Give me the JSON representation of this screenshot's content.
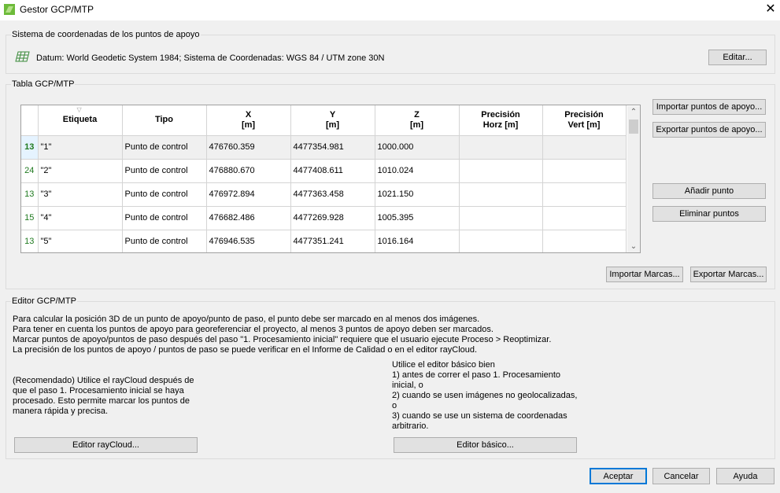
{
  "window": {
    "title": "Gestor GCP/MTP",
    "close": "✕"
  },
  "coords": {
    "group_label": "Sistema de coordenadas de los puntos de apoyo",
    "datum": "Datum: World Geodetic System 1984; Sistema de Coordenadas: WGS 84 / UTM zone 30N",
    "edit_button": "Editar..."
  },
  "table": {
    "group_label": "Tabla GCP/MTP",
    "headers": {
      "label": "Etiqueta",
      "type": "Tipo",
      "x": "X",
      "y": "Y",
      "z": "Z",
      "unit": "[m]",
      "prec": "Precisión",
      "horz": "Horz [m]",
      "vert": "Vert [m]"
    },
    "rows": [
      {
        "count": "13",
        "label": "\"1\"",
        "type": "Punto de control",
        "x": "476760.359",
        "y": "4477354.981",
        "z": "1000.000",
        "ph": "",
        "pv": ""
      },
      {
        "count": "24",
        "label": "\"2\"",
        "type": "Punto de control",
        "x": "476880.670",
        "y": "4477408.611",
        "z": "1010.024",
        "ph": "",
        "pv": ""
      },
      {
        "count": "13",
        "label": "\"3\"",
        "type": "Punto de control",
        "x": "476972.894",
        "y": "4477363.458",
        "z": "1021.150",
        "ph": "",
        "pv": ""
      },
      {
        "count": "15",
        "label": "\"4\"",
        "type": "Punto de control",
        "x": "476682.486",
        "y": "4477269.928",
        "z": "1005.395",
        "ph": "",
        "pv": ""
      },
      {
        "count": "13",
        "label": "\"5\"",
        "type": "Punto de control",
        "x": "476946.535",
        "y": "4477351.241",
        "z": "1016.164",
        "ph": "",
        "pv": ""
      }
    ],
    "buttons": {
      "import_gcp": "Importar puntos de apoyo...",
      "export_gcp": "Exportar puntos de apoyo...",
      "add_point": "Añadir punto",
      "remove_points": "Eliminar puntos",
      "import_marks": "Importar Marcas...",
      "export_marks": "Exportar Marcas..."
    }
  },
  "editor": {
    "group_label": "Editor GCP/MTP",
    "intro": [
      "Para calcular la posición 3D de un punto de apoyo/punto de paso, el punto debe ser marcado en al menos dos imágenes.",
      "Para tener en cuenta los puntos de apoyo para georeferenciar el proyecto, al menos 3 puntos de apoyo deben ser marcados.",
      "Marcar puntos de apoyo/puntos de paso después del paso \"1. Procesamiento inicial\" requiere que el usuario ejecute Proceso > Reoptimizar.",
      "La precisión de los puntos de apoyo / puntos de paso se puede verificar en el Informe de Calidad o en el editor rayCloud."
    ],
    "raycloud_text": [
      "(Recomendado) Utilice el rayCloud después de",
      "que el paso 1. Procesamiento inicial se haya",
      "procesado. Esto permite marcar los puntos de",
      "manera rápida y precisa."
    ],
    "basic_text": [
      "Utilice el editor básico bien",
      "1) antes de correr el paso 1. Procesamiento",
      "inicial, o",
      "2) cuando se usen imágenes no geolocalizadas,",
      "o",
      "3) cuando se use un sistema de coordenadas",
      "arbitrario."
    ],
    "raycloud_button": "Editor rayCloud...",
    "basic_button": "Editor básico..."
  },
  "footer": {
    "accept": "Aceptar",
    "cancel": "Cancelar",
    "help": "Ayuda"
  },
  "colors": {
    "accent": "#0078d7",
    "count_green": "#1f7a1f",
    "selected_cell": "#e5f3ff"
  }
}
